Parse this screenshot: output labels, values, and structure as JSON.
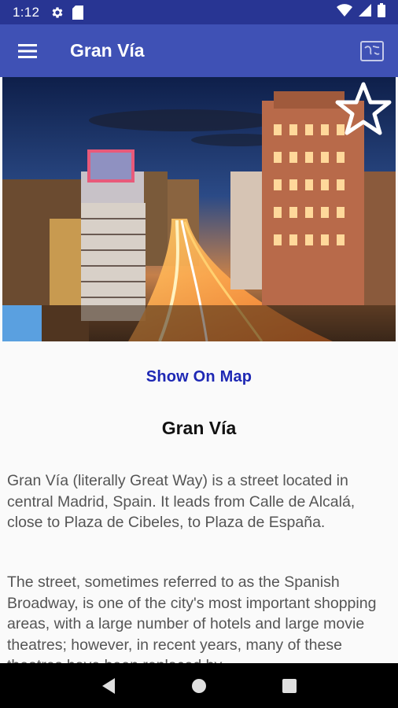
{
  "status_bar": {
    "time": "1:12",
    "icons_left": [
      "gear-icon",
      "sd-card-icon"
    ],
    "icons_right": [
      "wifi-icon",
      "signal-icon",
      "battery-icon"
    ]
  },
  "app_bar": {
    "title": "Gran Vía",
    "menu_icon": "menu-icon",
    "map_icon": "map-icon",
    "color": "#3f51b5"
  },
  "hero": {
    "favorite_icon": "star-outline-icon"
  },
  "content": {
    "map_link": "Show On Map",
    "title": "Gran Vía",
    "paragraph_1": "Gran Vía (literally Great Way) is a street located in central Madrid, Spain. It leads from Calle de Alcalá, close to Plaza de Cibeles, to Plaza de España.",
    "paragraph_2": "The street, sometimes referred to as the Spanish Broadway, is one of the city's most important shopping areas, with a large number of hotels and large movie theatres; however, in recent years, many of these theatres have been replaced by",
    "link_color": "#1e28b4"
  },
  "nav_bar": {
    "back_icon": "back-triangle-icon",
    "home_icon": "home-circle-icon",
    "recents_icon": "recents-square-icon"
  }
}
